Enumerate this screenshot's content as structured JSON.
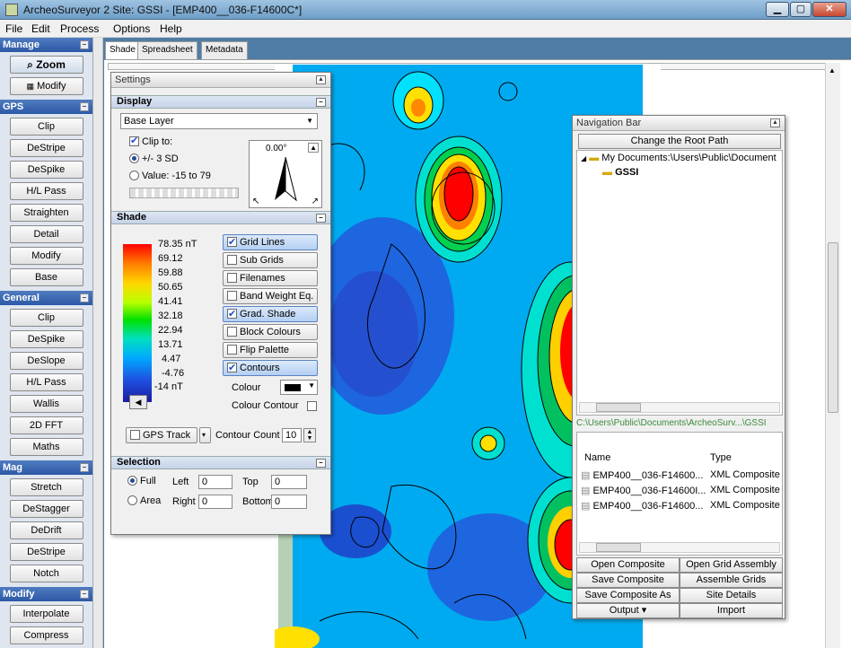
{
  "window": {
    "title": "ArcheoSurveyor 2 Site: GSSI - [EMP400__036-F14600C*]",
    "min": "▁",
    "max": "▢",
    "close": "✕"
  },
  "menu": [
    "File",
    "Edit",
    "Process",
    "Options",
    "Help"
  ],
  "toolbar": {
    "groups": [
      {
        "title": "Manage",
        "items": [
          "Zoom",
          "Modify"
        ]
      },
      {
        "title": "GPS",
        "items": [
          "Clip",
          "DeStripe",
          "DeSpike",
          "H/L Pass",
          "Straighten",
          "Detail",
          "Modify",
          "Base"
        ]
      },
      {
        "title": "General",
        "items": [
          "Clip",
          "DeSpike",
          "DeSlope",
          "H/L Pass",
          "Wallis",
          "2D FFT",
          "Maths"
        ]
      },
      {
        "title": "Mag",
        "items": [
          "Stretch",
          "DeStagger",
          "DeDrift",
          "DeStripe",
          "Notch"
        ]
      },
      {
        "title": "Modify",
        "items": [
          "Interpolate",
          "Compress"
        ]
      }
    ]
  },
  "tabs": [
    "Shade",
    "Spreadsheet",
    "Metadata"
  ],
  "settings": {
    "title": "Settings",
    "display": {
      "header": "Display",
      "layer": "Base Layer",
      "clip_to": "Clip to:",
      "sd_option": "+/- 3 SD",
      "value_option": "Value: -15 to 79",
      "north": "0.00°"
    },
    "shade": {
      "header": "Shade",
      "scale": [
        "78.35 nT",
        "69.12",
        "59.88",
        "50.65",
        "41.41",
        "32.18",
        "22.94",
        "13.71",
        "4.47",
        "-4.76",
        "-14 nT"
      ],
      "options": [
        {
          "label": "Grid Lines",
          "checked": true
        },
        {
          "label": "Sub Grids",
          "checked": false
        },
        {
          "label": "Filenames",
          "checked": false
        },
        {
          "label": "Band Weight Eq.",
          "checked": false
        },
        {
          "label": "Grad. Shade",
          "checked": true
        },
        {
          "label": "Block Colours",
          "checked": false
        },
        {
          "label": "Flip Palette",
          "checked": false
        },
        {
          "label": "Contours",
          "checked": true
        }
      ],
      "colour_label": "Colour",
      "colour_contour": "Colour Contour",
      "gps_track": "GPS Track",
      "contour_count_label": "Contour Count",
      "contour_count": "10"
    },
    "selection": {
      "header": "Selection",
      "full": "Full",
      "area": "Area",
      "left_label": "Left",
      "left": "0",
      "top_label": "Top",
      "top": "0",
      "right_label": "Right",
      "right": "0",
      "bottom_label": "Bottom",
      "bottom": "0"
    }
  },
  "nav": {
    "title": "Navigation Bar",
    "change_root": "Change the Root Path",
    "tree_root": "My Documents:\\Users\\Public\\Document",
    "tree_child": "GSSI",
    "path": "C:\\Users\\Public\\Documents\\ArcheoSurv...\\GSSI",
    "col_name": "Name",
    "col_type": "Type",
    "files": [
      {
        "name": "EMP400__036-F14600...",
        "type": "XML Composite"
      },
      {
        "name": "EMP400__036-F14600I...",
        "type": "XML Composite"
      },
      {
        "name": "EMP400__036-F14600...",
        "type": "XML Composite"
      }
    ],
    "buttons": [
      "Open Composite",
      "Open Grid Assembly",
      "Save Composite",
      "Assemble Grids",
      "Save Composite As",
      "Site Details",
      "Output ▾",
      "Import"
    ]
  },
  "colors": {
    "accent": "#2c58a6",
    "palette_top": "#ff0000",
    "palette_bottom": "#1f1fa0"
  }
}
